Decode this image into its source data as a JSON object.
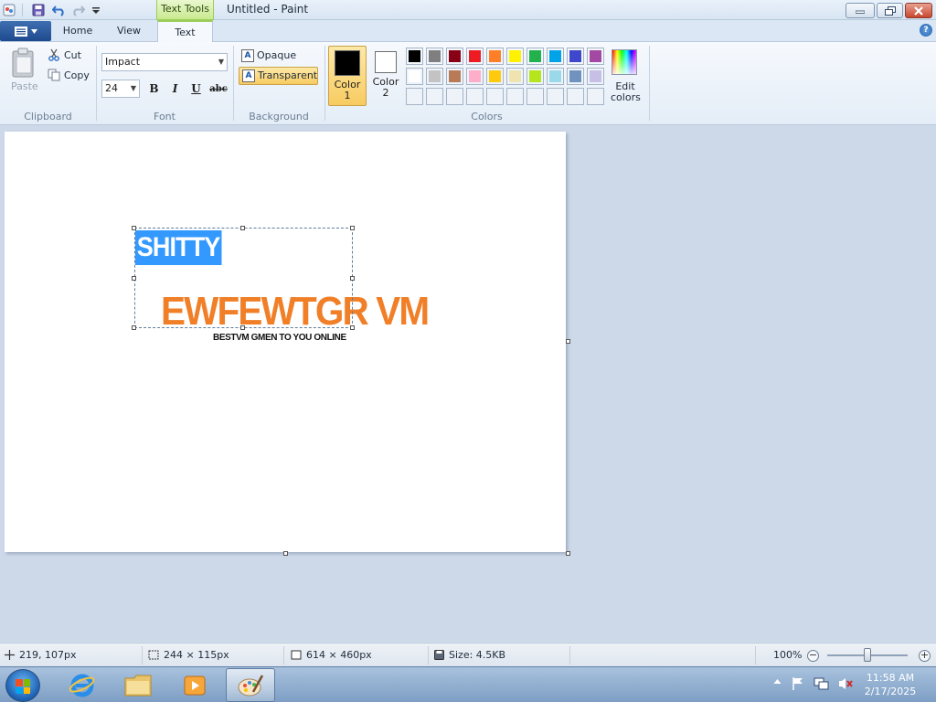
{
  "window": {
    "title": "Untitled - Paint",
    "context_tab": "Text Tools"
  },
  "tabs": {
    "home": "Home",
    "view": "View",
    "text": "Text"
  },
  "clipboard": {
    "paste": "Paste",
    "cut": "Cut",
    "copy": "Copy",
    "label": "Clipboard"
  },
  "font": {
    "family": "Impact",
    "size": "24",
    "bold": "B",
    "italic": "I",
    "underline": "U",
    "strikethrough": "abc",
    "label": "Font"
  },
  "background": {
    "opaque": "Opaque",
    "transparent": "Transparent",
    "label": "Background",
    "selected": "Transparent"
  },
  "colors": {
    "color1_label": "Color 1",
    "color1_line1": "Color",
    "color1_line2": "1",
    "color2_line1": "Color",
    "color2_line2": "2",
    "color1": "#000000",
    "color2": "#ffffff",
    "edit_line1": "Edit",
    "edit_line2": "colors",
    "label": "Colors",
    "palette_row1": [
      "#000000",
      "#7f7f7f",
      "#880015",
      "#ed1c24",
      "#ff7f27",
      "#fff200",
      "#22b14c",
      "#00a2e8",
      "#3f48cc",
      "#a349a4"
    ],
    "palette_row2": [
      "#ffffff",
      "#c3c3c3",
      "#b97a57",
      "#ffaec9",
      "#ffc90e",
      "#efe4b0",
      "#b5e61d",
      "#99d9ea",
      "#7092be",
      "#c8bfe7"
    ]
  },
  "canvas": {
    "selected_text": "SHITTY",
    "headline": "EWFEWTGR VM",
    "headline_color": "#f07f28",
    "tagline": "BESTVM GMEN TO YOU ONLINE"
  },
  "status": {
    "cursor": "219, 107px",
    "selection": "244 × 115px",
    "canvas_size": "614 × 460px",
    "file_size": "Size: 4.5KB",
    "zoom": "100%"
  },
  "taskbar": {
    "time": "11:58 AM",
    "date": "2/17/2025"
  }
}
